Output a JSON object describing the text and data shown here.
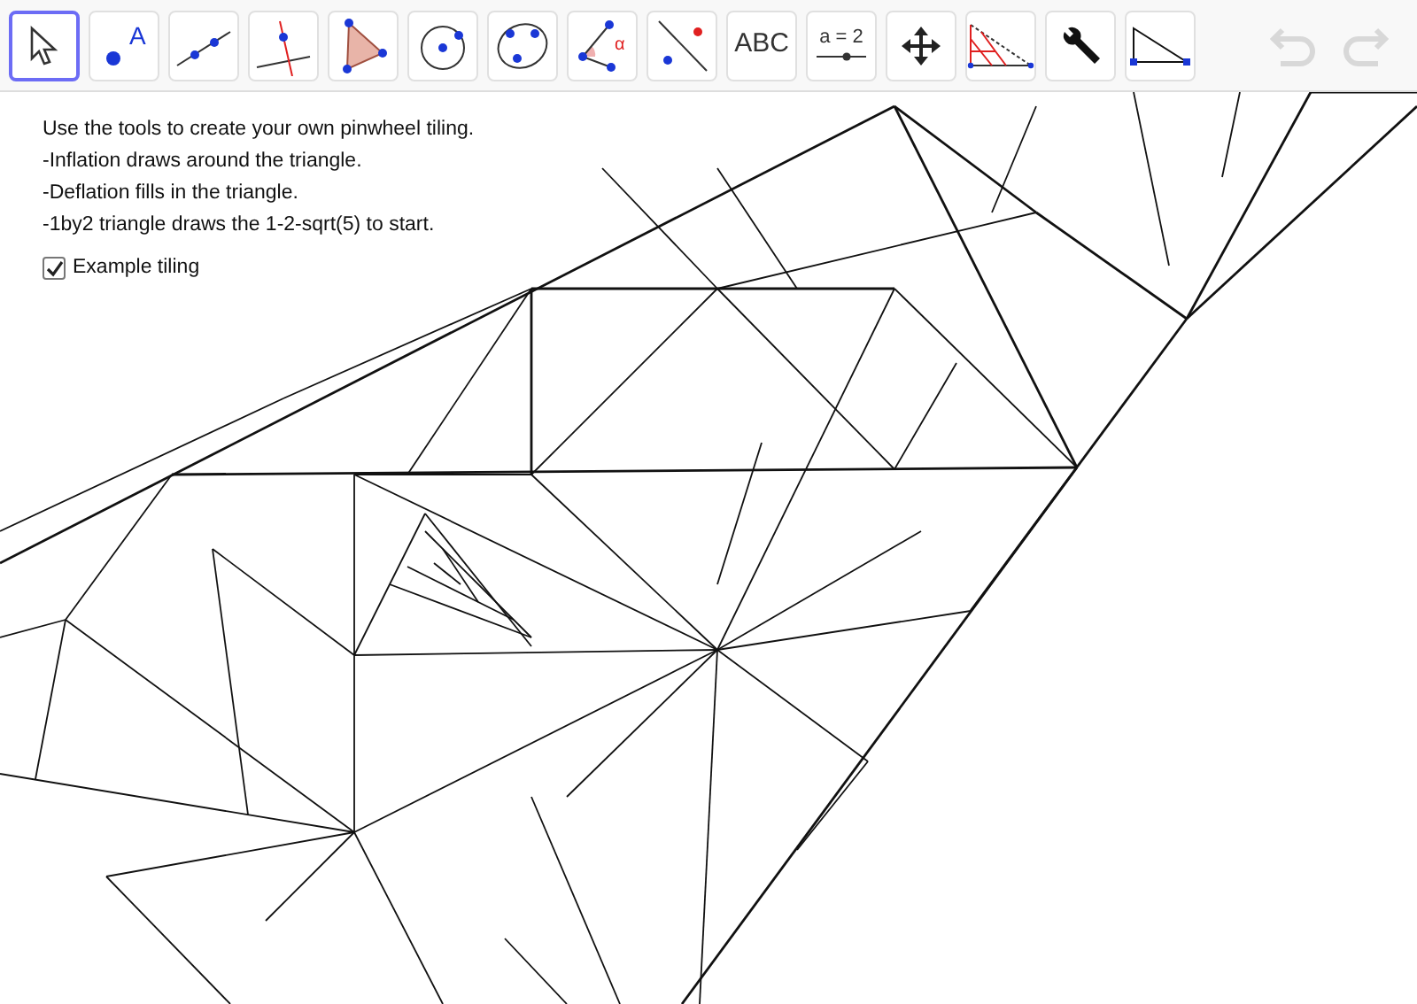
{
  "toolbar": {
    "tools": [
      {
        "kind": "move",
        "selected": true
      },
      {
        "kind": "point",
        "selected": false,
        "label": "A"
      },
      {
        "kind": "line",
        "selected": false
      },
      {
        "kind": "perpendicular",
        "selected": false
      },
      {
        "kind": "polygon",
        "selected": false
      },
      {
        "kind": "circle",
        "selected": false
      },
      {
        "kind": "conic",
        "selected": false
      },
      {
        "kind": "angle",
        "selected": false,
        "label": "α"
      },
      {
        "kind": "reflect",
        "selected": false
      },
      {
        "kind": "text",
        "selected": false,
        "label": "ABC"
      },
      {
        "kind": "slider",
        "selected": false,
        "label": "a = 2"
      },
      {
        "kind": "pan",
        "selected": false
      },
      {
        "kind": "pinwheel",
        "selected": false
      },
      {
        "kind": "settings",
        "selected": false
      },
      {
        "kind": "triangle",
        "selected": false
      }
    ],
    "undo": {
      "disabled": true
    },
    "redo": {
      "disabled": true
    }
  },
  "notes": [
    "Use the tools to create your own pinwheel tiling.",
    "-Inflation draws around the triangle.",
    "-Deflation fills in the triangle.",
    "-1by2 triangle draws the 1-2-sqrt(5) to start."
  ],
  "example_tiling": {
    "label": "Example tiling",
    "checked": true
  }
}
